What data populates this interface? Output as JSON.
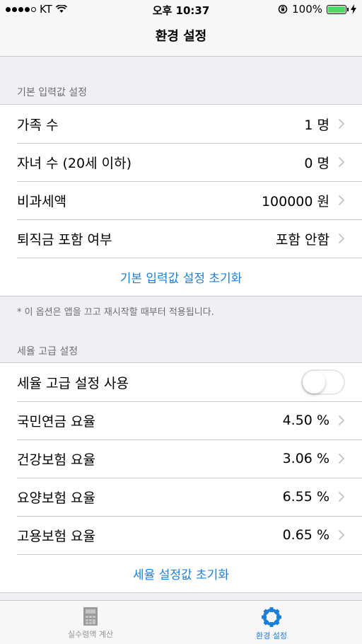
{
  "status_bar": {
    "carrier": "KT",
    "time": "오후 10:37",
    "battery": "100%",
    "battery_level": 1.0
  },
  "nav": {
    "title": "환경 설정"
  },
  "basic_section": {
    "header": "기본 입력값 설정",
    "rows": [
      {
        "label": "가족 수",
        "value": "1 명"
      },
      {
        "label": "자녀 수 (20세 이하)",
        "value": "0 명"
      },
      {
        "label": "비과세액",
        "value": "100000 원"
      },
      {
        "label": "퇴직금 포함 여부",
        "value": "포함 안함"
      }
    ],
    "reset_label": "기본 입력값 설정 초기화",
    "footnote": "* 이 옵션은 앱을 끄고 재시작할 때부터 적용됩니다."
  },
  "rate_section": {
    "header": "세율 고급 설정",
    "toggle_label": "세율 고급 설정 사용",
    "toggle_on": false,
    "rows": [
      {
        "label": "국민연금 요율",
        "value": "4.50 %"
      },
      {
        "label": "건강보험 요율",
        "value": "3.06 %"
      },
      {
        "label": "요양보험 요율",
        "value": "6.55 %"
      },
      {
        "label": "고용보험 요율",
        "value": "0.65 %"
      }
    ],
    "reset_label": "세율 설정값 초기화"
  },
  "tab_bar": {
    "tabs": [
      {
        "label": "실수령액 계산",
        "icon": "calculator-icon",
        "active": false
      },
      {
        "label": "환경 설정",
        "icon": "gear-icon",
        "active": true
      }
    ]
  },
  "colors": {
    "accent": "#1a7fd6",
    "background": "#efeff4",
    "battery": "#4cd964"
  }
}
